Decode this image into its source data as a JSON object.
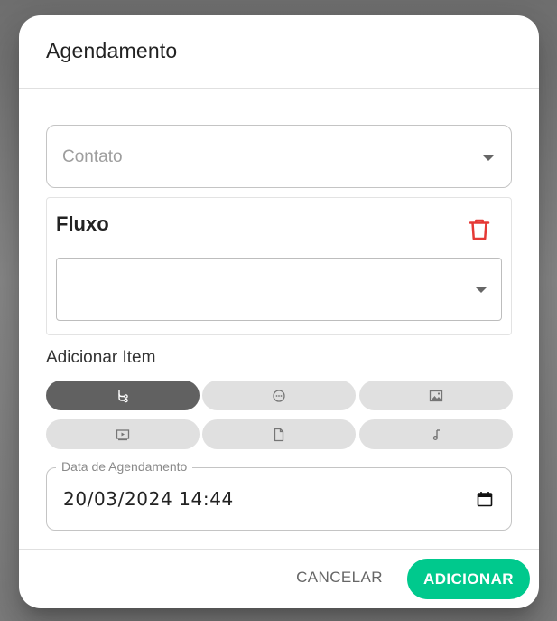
{
  "dialog": {
    "title": "Agendamento"
  },
  "contact_select": {
    "placeholder": "Contato"
  },
  "flow_card": {
    "title": "Fluxo",
    "selected_value": ""
  },
  "add_item": {
    "label": "Adicionar Item",
    "types": [
      {
        "name": "flow",
        "icon": "flow-icon",
        "active": true
      },
      {
        "name": "message",
        "icon": "chat-bubble-icon",
        "active": false
      },
      {
        "name": "image",
        "icon": "image-icon",
        "active": false
      },
      {
        "name": "video",
        "icon": "video-icon",
        "active": false
      },
      {
        "name": "document",
        "icon": "document-icon",
        "active": false
      },
      {
        "name": "audio",
        "icon": "music-note-icon",
        "active": false
      }
    ]
  },
  "schedule_date": {
    "label": "Data de Agendamento",
    "value": "20/03/2024 14:44"
  },
  "actions": {
    "cancel_label": "CANCELAR",
    "add_label": "ADICIONAR"
  },
  "colors": {
    "primary": "#00c98d",
    "delete": "#e53935",
    "active_chip": "#616161",
    "chip": "#e0e0e0"
  }
}
